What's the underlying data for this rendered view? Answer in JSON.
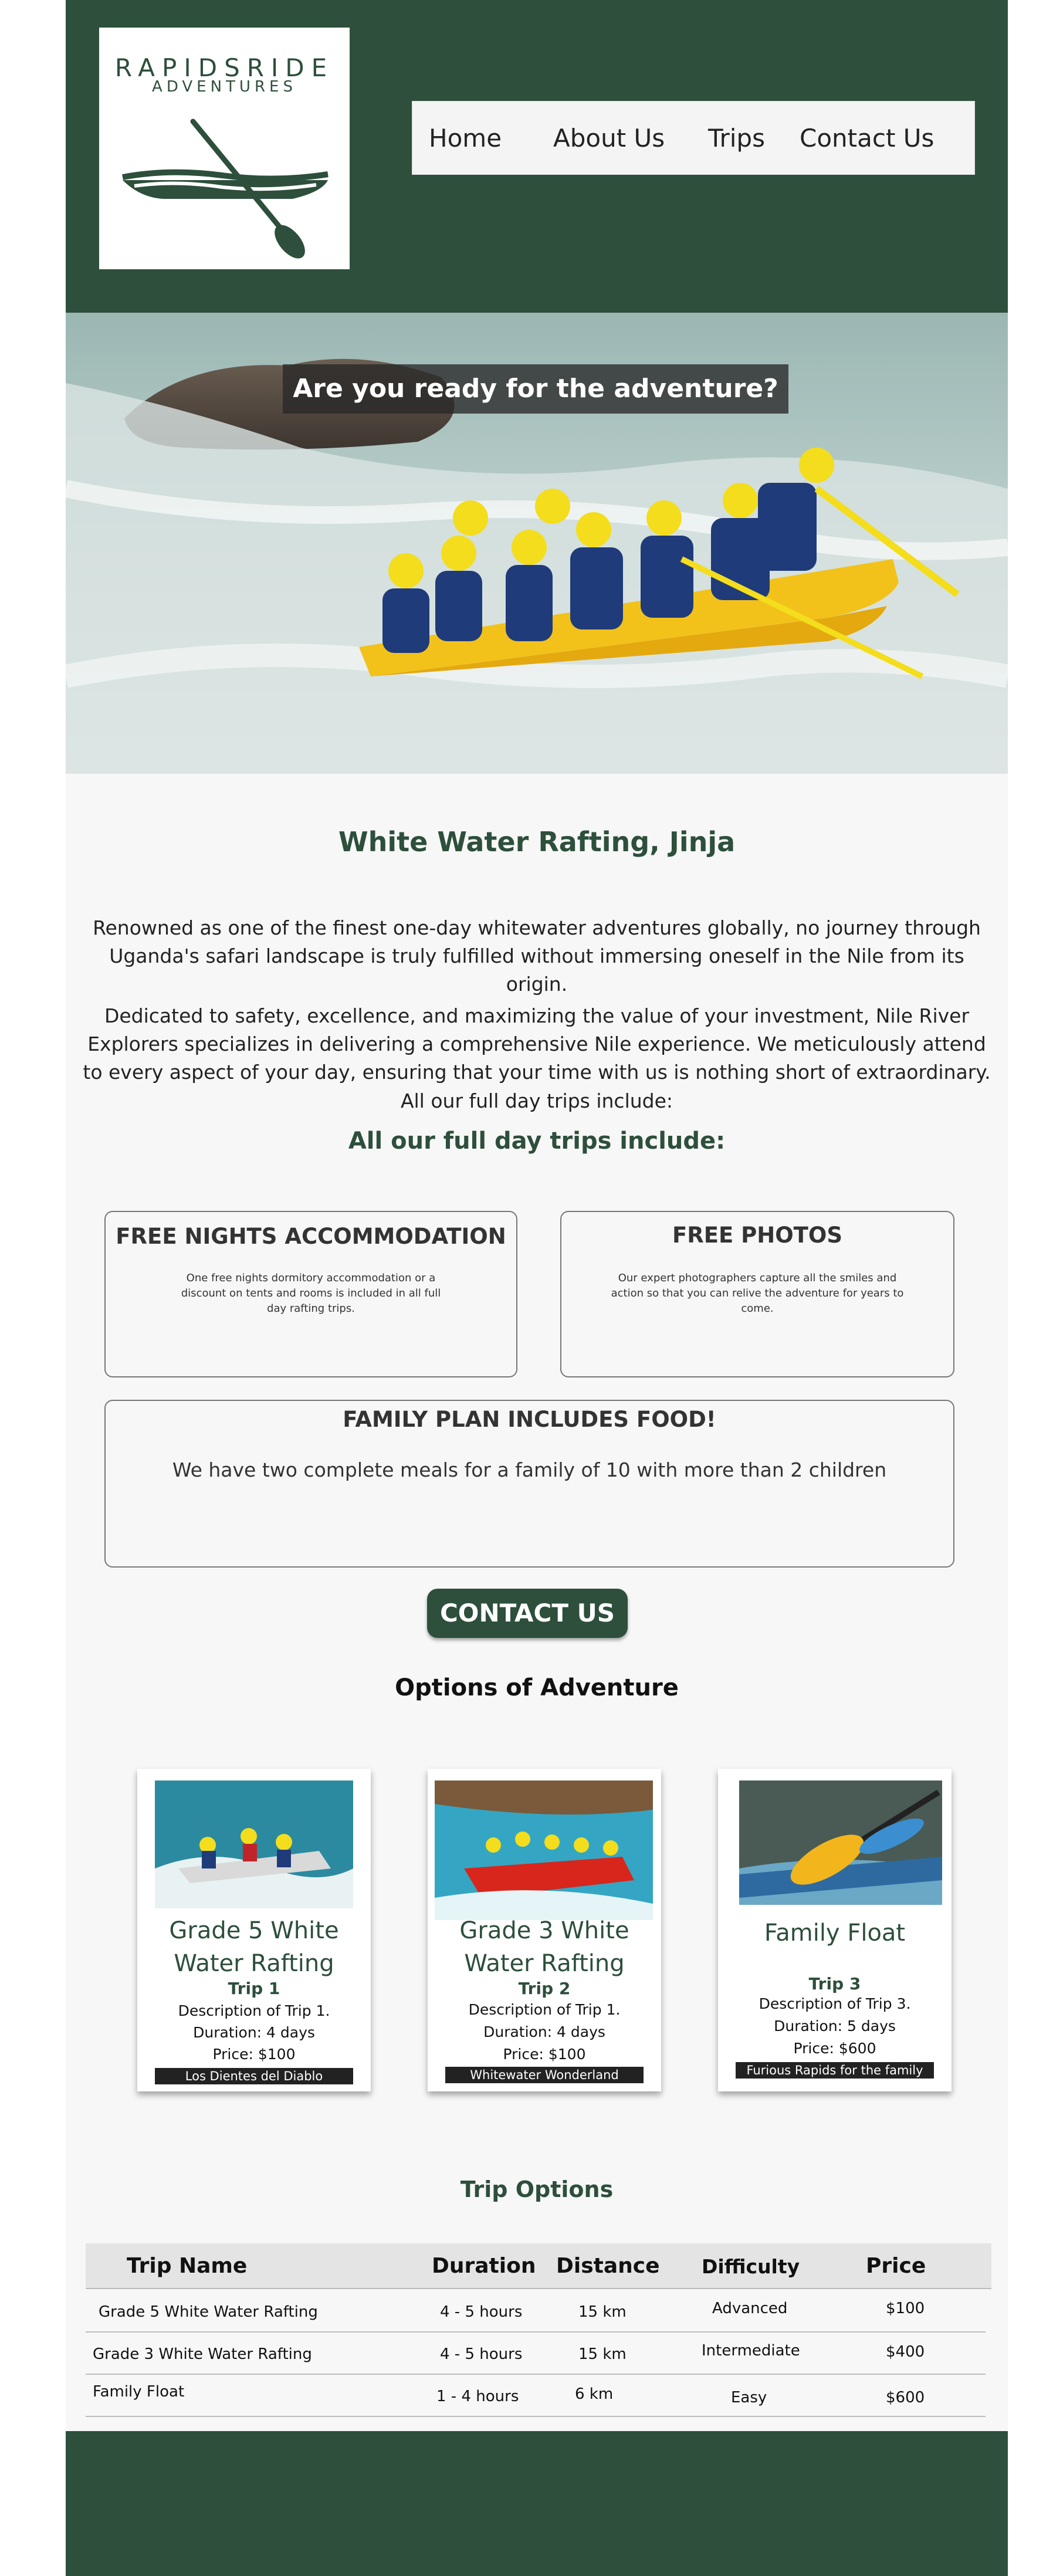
{
  "brand": {
    "name": "RAPIDSRIDE",
    "sub": "ADVENTURES",
    "color": "#2d4f3b"
  },
  "nav": {
    "items": [
      "Home",
      "About Us",
      "Trips",
      "Contact Us"
    ]
  },
  "hero": {
    "banner": "Are you ready for the adventure?"
  },
  "intro": {
    "title": "White Water Rafting, Jinja",
    "p1": "Renowned as one of the finest one-day whitewater adventures globally, no journey through Uganda's safari landscape is truly fulfilled without immersing oneself in the Nile from its origin.",
    "p2": "Dedicated to safety, excellence, and maximizing the value of your investment, Nile River Explorers specializes in delivering a comprehensive Nile experience. We meticulously attend to every aspect of your day, ensuring that your time with us is nothing short of extraordinary.",
    "p3": "All our full day trips include:",
    "subtitle": "All our full day trips include:"
  },
  "features": [
    {
      "title": "FREE NIGHTS ACCOMMODATION",
      "text": "One free nights dormitory accommodation or a discount on tents and rooms is included in all full day rafting trips."
    },
    {
      "title": "FREE PHOTOS",
      "text": "Our expert photographers capture all the smiles and action so that you can relive the adventure for years to come."
    },
    {
      "title": "FAMILY PLAN INCLUDES FOOD!",
      "text": "We have two complete meals for a family of 10 with more than 2 children"
    }
  ],
  "contact_button": "CONTACT US",
  "options": {
    "title": "Options of Adventure",
    "cards": [
      {
        "name": "Grade 5 White Water Rafting",
        "trip": "Trip 1",
        "desc": "Description of Trip 1.",
        "duration": "Duration: 4 days",
        "price": "Price: $100",
        "tag": "Los Dientes del Diablo"
      },
      {
        "name": "Grade 3 White Water Rafting",
        "trip": "Trip 2",
        "desc": "Description of Trip 1.",
        "duration": "Duration: 4 days",
        "price": "Price: $100",
        "tag": "Whitewater Wonderland"
      },
      {
        "name": "Family Float",
        "trip": "Trip 3",
        "desc": "Description of Trip 3.",
        "duration": "Duration: 5 days",
        "price": "Price: $600",
        "tag": "Furious Rapids for the family"
      }
    ]
  },
  "trip_table": {
    "title": "Trip Options",
    "headers": [
      "Trip Name",
      "Duration",
      "Distance",
      "Difficulty",
      "Price"
    ],
    "rows": [
      [
        "Grade 5 White Water Rafting",
        "4 - 5 hours",
        "15 km",
        "Advanced",
        "$100"
      ],
      [
        "Grade 3 White Water Rafting",
        "4 - 5 hours",
        "15 km",
        "Intermediate",
        "$400"
      ],
      [
        "Family Float",
        "1 - 4 hours",
        "6 km",
        "Easy",
        "$600"
      ]
    ]
  }
}
